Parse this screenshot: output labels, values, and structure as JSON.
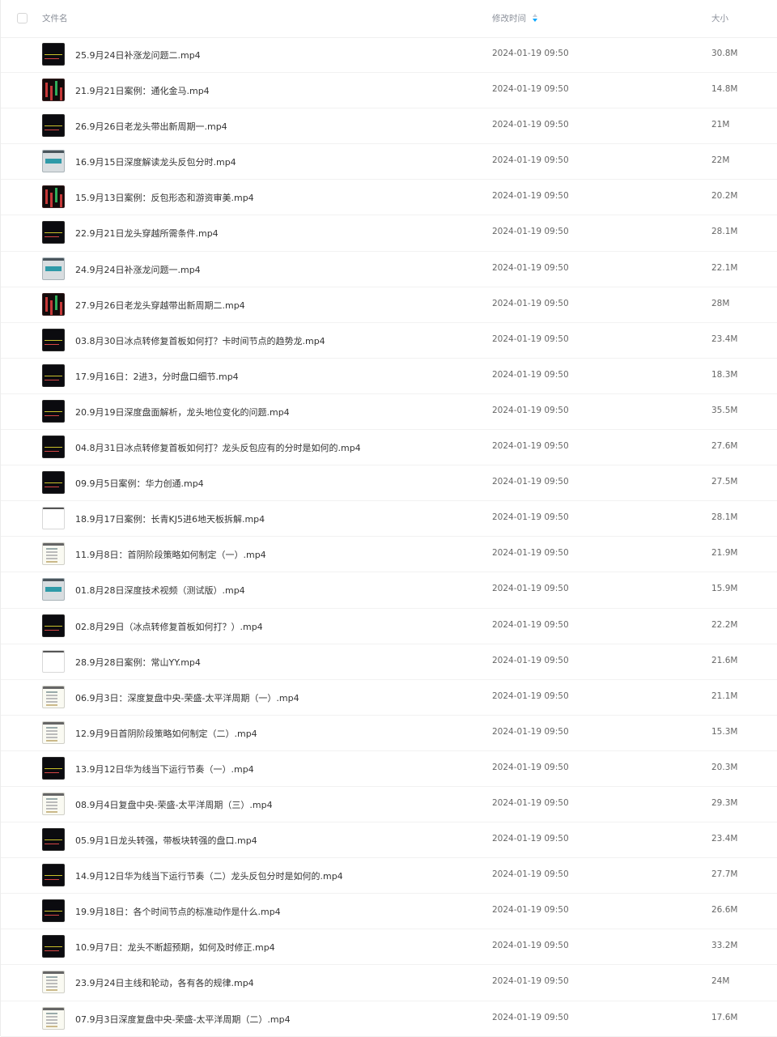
{
  "header": {
    "name_label": "文件名",
    "time_label": "修改时间",
    "size_label": "大小"
  },
  "colors": {
    "accent": "#06a7ff"
  },
  "files": [
    {
      "name": "25.9月24日补涨龙问题二.mp4",
      "time": "2024-01-19 09:50",
      "size": "30.8M",
      "thumb": "dark"
    },
    {
      "name": "21.9月21日案例：通化金马.mp4",
      "time": "2024-01-19 09:50",
      "size": "14.8M",
      "thumb": "red"
    },
    {
      "name": "26.9月26日老龙头带出新周期一.mp4",
      "time": "2024-01-19 09:50",
      "size": "21M",
      "thumb": "dark"
    },
    {
      "name": "16.9月15日深度解读龙头反包分时.mp4",
      "time": "2024-01-19 09:50",
      "size": "22M",
      "thumb": "teal"
    },
    {
      "name": "15.9月13日案例：反包形态和游资审美.mp4",
      "time": "2024-01-19 09:50",
      "size": "20.2M",
      "thumb": "red"
    },
    {
      "name": "22.9月21日龙头穿越所需条件.mp4",
      "time": "2024-01-19 09:50",
      "size": "28.1M",
      "thumb": "dark"
    },
    {
      "name": "24.9月24日补涨龙问题一.mp4",
      "time": "2024-01-19 09:50",
      "size": "22.1M",
      "thumb": "teal"
    },
    {
      "name": "27.9月26日老龙头穿越带出新周期二.mp4",
      "time": "2024-01-19 09:50",
      "size": "28M",
      "thumb": "red"
    },
    {
      "name": "03.8月30日冰点转修复首板如何打？卡时间节点的趋势龙.mp4",
      "time": "2024-01-19 09:50",
      "size": "23.4M",
      "thumb": "dark"
    },
    {
      "name": "17.9月16日：2进3，分时盘口细节.mp4",
      "time": "2024-01-19 09:50",
      "size": "18.3M",
      "thumb": "dark"
    },
    {
      "name": "20.9月19日深度盘面解析，龙头地位变化的问题.mp4",
      "time": "2024-01-19 09:50",
      "size": "35.5M",
      "thumb": "dark"
    },
    {
      "name": "04.8月31日冰点转修复首板如何打？龙头反包应有的分时是如何的.mp4",
      "time": "2024-01-19 09:50",
      "size": "27.6M",
      "thumb": "dark"
    },
    {
      "name": "09.9月5日案例：华力创通.mp4",
      "time": "2024-01-19 09:50",
      "size": "27.5M",
      "thumb": "dark"
    },
    {
      "name": "18.9月17日案例：长青KJ5进6地天板拆解.mp4",
      "time": "2024-01-19 09:50",
      "size": "28.1M",
      "thumb": "white"
    },
    {
      "name": "11.9月8日：首阴阶段策略如何制定（一）.mp4",
      "time": "2024-01-19 09:50",
      "size": "21.9M",
      "thumb": "doc"
    },
    {
      "name": "01.8月28日深度技术视频（测试版）.mp4",
      "time": "2024-01-19 09:50",
      "size": "15.9M",
      "thumb": "teal"
    },
    {
      "name": "02.8月29日（冰点转修复首板如何打？）.mp4",
      "time": "2024-01-19 09:50",
      "size": "22.2M",
      "thumb": "dark"
    },
    {
      "name": "28.9月28日案例：常山YY.mp4",
      "time": "2024-01-19 09:50",
      "size": "21.6M",
      "thumb": "white"
    },
    {
      "name": "06.9月3日：深度复盘中央-荣盛-太平洋周期（一）.mp4",
      "time": "2024-01-19 09:50",
      "size": "21.1M",
      "thumb": "doc"
    },
    {
      "name": "12.9月9日首阴阶段策略如何制定（二）.mp4",
      "time": "2024-01-19 09:50",
      "size": "15.3M",
      "thumb": "doc"
    },
    {
      "name": "13.9月12日华为线当下运行节奏（一）.mp4",
      "time": "2024-01-19 09:50",
      "size": "20.3M",
      "thumb": "dark"
    },
    {
      "name": "08.9月4日复盘中央-荣盛-太平洋周期（三）.mp4",
      "time": "2024-01-19 09:50",
      "size": "29.3M",
      "thumb": "doc"
    },
    {
      "name": "05.9月1日龙头转强，带板块转强的盘口.mp4",
      "time": "2024-01-19 09:50",
      "size": "23.4M",
      "thumb": "dark"
    },
    {
      "name": "14.9月12日华为线当下运行节奏（二）龙头反包分时是如何的.mp4",
      "time": "2024-01-19 09:50",
      "size": "27.7M",
      "thumb": "dark"
    },
    {
      "name": "19.9月18日：各个时间节点的标准动作是什么.mp4",
      "time": "2024-01-19 09:50",
      "size": "26.6M",
      "thumb": "dark"
    },
    {
      "name": "10.9月7日：龙头不断超预期，如何及时修正.mp4",
      "time": "2024-01-19 09:50",
      "size": "33.2M",
      "thumb": "dark"
    },
    {
      "name": "23.9月24日主线和轮动，各有各的规律.mp4",
      "time": "2024-01-19 09:50",
      "size": "24M",
      "thumb": "doc"
    },
    {
      "name": "07.9月3日深度复盘中央-荣盛-太平洋周期（二）.mp4",
      "time": "2024-01-19 09:50",
      "size": "17.6M",
      "thumb": "doc"
    }
  ]
}
